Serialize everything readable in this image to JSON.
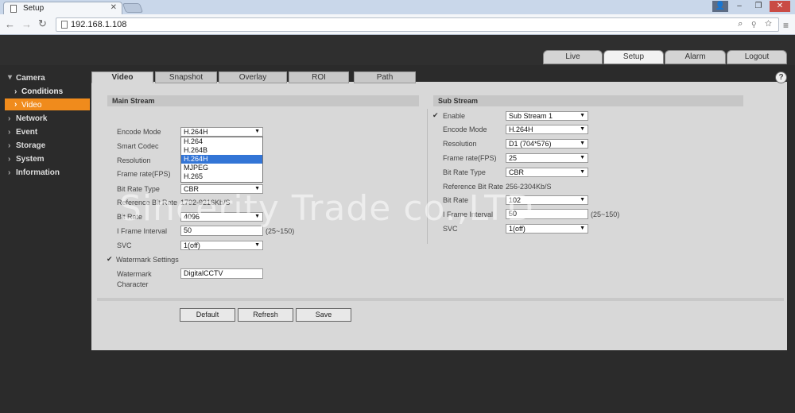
{
  "browser": {
    "tab_title": "Setup",
    "url": "192.168.1.108"
  },
  "top_tabs": [
    "Live",
    "Setup",
    "Alarm",
    "Logout"
  ],
  "sidebar": {
    "camera": "Camera",
    "conditions": "Conditions",
    "video": "Video",
    "network": "Network",
    "event": "Event",
    "storage": "Storage",
    "system": "System",
    "information": "Information"
  },
  "sub_tabs": [
    "Video",
    "Snapshot",
    "Overlay",
    "ROI",
    "Path"
  ],
  "main_stream": {
    "title": "Main Stream",
    "encode_mode_label": "Encode Mode",
    "encode_mode_value": "H.264H",
    "encode_options": [
      "H.264",
      "H.264B",
      "H.264H",
      "MJPEG",
      "H.265"
    ],
    "smart_codec_label": "Smart Codec",
    "resolution_label": "Resolution",
    "frame_rate_label": "Frame rate(FPS)",
    "bit_rate_type_label": "Bit Rate Type",
    "bit_rate_type_value": "CBR",
    "reference_bit_rate_label": "Reference Bit Rate",
    "reference_bit_rate_value": "1792-9216Kb/S",
    "bit_rate_label": "Bit Rate",
    "bit_rate_value": "4096",
    "iframe_interval_label": "I Frame Interval",
    "iframe_interval_value": "50",
    "iframe_interval_range": "(25~150)",
    "svc_label": "SVC",
    "svc_value": "1(off)",
    "watermark_settings_label": "Watermark Settings",
    "watermark_character_label_1": "Watermark",
    "watermark_character_label_2": "Character",
    "watermark_character_value": "DigitalCCTV"
  },
  "sub_stream": {
    "title": "Sub Stream",
    "enable_label": "Enable",
    "enable_value": "Sub Stream 1",
    "encode_mode_label": "Encode Mode",
    "encode_mode_value": "H.264H",
    "resolution_label": "Resolution",
    "resolution_value": "D1 (704*576)",
    "frame_rate_label": "Frame rate(FPS)",
    "frame_rate_value": "25",
    "bit_rate_type_label": "Bit Rate Type",
    "bit_rate_type_value": "CBR",
    "reference_bit_rate_label": "Reference Bit Rate",
    "reference_bit_rate_value": "256-2304Kb/S",
    "bit_rate_label": "Bit Rate",
    "bit_rate_value": "102",
    "iframe_interval_label": "I Frame Interval",
    "iframe_interval_value": "50",
    "iframe_interval_range": "(25~150)",
    "svc_label": "SVC",
    "svc_value": "1(off)"
  },
  "buttons": {
    "default": "Default",
    "refresh": "Refresh",
    "save": "Save"
  },
  "watermark_overlay": "Sincerity Trade co.,LTD"
}
